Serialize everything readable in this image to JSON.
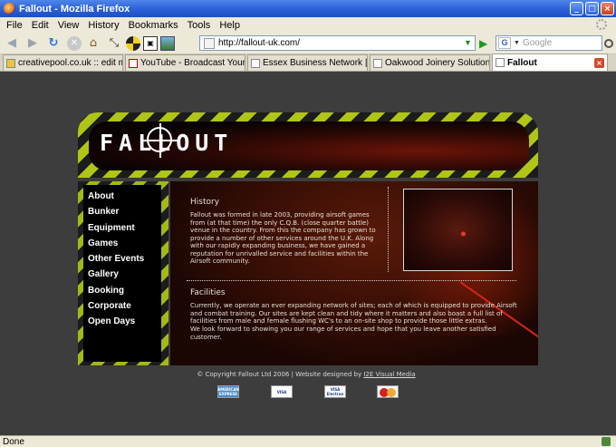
{
  "window": {
    "title": "Fallout - Mozilla Firefox"
  },
  "menu": [
    "File",
    "Edit",
    "View",
    "History",
    "Bookmarks",
    "Tools",
    "Help"
  ],
  "address": {
    "url": "http://fallout-uk.com/"
  },
  "search": {
    "placeholder": "Google",
    "engine_letter": "G"
  },
  "tabs": [
    {
      "label": "creativepool.co.uk :: edit m..."
    },
    {
      "label": "YouTube - Broadcast Yourself."
    },
    {
      "label": "Essex Business Network | B..."
    },
    {
      "label": "Oakwood Joinery Solutions ..."
    },
    {
      "label": "Fallout"
    }
  ],
  "site": {
    "logo_text": "FALLOUT",
    "nav": [
      "About",
      "Bunker",
      "Equipment",
      "Games",
      "Other Events",
      "Gallery",
      "Booking",
      "Corporate",
      "Open Days"
    ],
    "history_title": "History",
    "history_text": "Fallout was formed in late 2003, providing airsoft games from (at that time) the only C.Q.B. (close quarter battle) venue in the country. From this the company has grown to provide a number of other services around the U.K. Along with our rapidly expanding business, we have gained a reputation for unrivalled service and facilities within the Airsoft community.",
    "facilities_title": "Facilities",
    "facilities_text": "Currently, we operate an ever expanding network of sites; each of which is equipped to provide Airsoft and combat training. Our sites are kept clean and tidy where it matters and also boast a full list of facilities from male and female flushing WC's to an on-site shop to provide those little extras.",
    "facilities_text2": "We look forward to showing you our range of services and hope that you leave another satisfied customer.",
    "footer_text": "© Copyright Fallout Ltd 2006 | Website designed by ",
    "footer_link": "I2E Visual Media",
    "cards": [
      "AMERICAN EXPRESS",
      "VISA",
      "VISA Electron",
      "MasterCard"
    ]
  },
  "status": {
    "text": "Done"
  }
}
